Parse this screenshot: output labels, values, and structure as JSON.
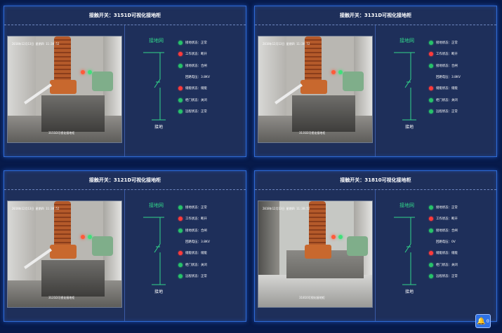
{
  "panels": [
    {
      "title": "接触开关：3151D可视化接地柜",
      "camera": {
        "timestamp": "2018年12月13日 星期四 11:38:52",
        "caption": "3151D可视化接地柜"
      },
      "diagram": {
        "top": "接地网",
        "bottom": "接地"
      },
      "status": [
        {
          "color": "green",
          "text": "接地状态：正常"
        },
        {
          "color": "red",
          "text": "工作状态：断开"
        },
        {
          "color": "green",
          "text": "接地状态：合闸"
        },
        {
          "color": "none",
          "text": "回路电压：3.8KV"
        },
        {
          "color": "red",
          "text": "储能状态：储能"
        },
        {
          "color": "green",
          "text": "柜门状态：关闭"
        },
        {
          "color": "green",
          "text": "远程状态：正常"
        }
      ]
    },
    {
      "title": "接触开关：3131D可视化接地柜",
      "camera": {
        "timestamp": "2018年12月13日 星期四 11:38:52",
        "caption": "3131D可视化接地柜"
      },
      "diagram": {
        "top": "接地网",
        "bottom": "接地"
      },
      "status": [
        {
          "color": "green",
          "text": "接地状态：正常"
        },
        {
          "color": "red",
          "text": "工作状态：断开"
        },
        {
          "color": "green",
          "text": "接地状态：合闸"
        },
        {
          "color": "none",
          "text": "回路电压：3.8KV"
        },
        {
          "color": "red",
          "text": "储能状态：储能"
        },
        {
          "color": "green",
          "text": "柜门状态：关闭"
        },
        {
          "color": "green",
          "text": "远程状态：正常"
        }
      ]
    },
    {
      "title": "接触开关：3121D可视化接地柜",
      "camera": {
        "timestamp": "2018年12月13日 星期四 11:38:52",
        "caption": "3121D可视化接地柜"
      },
      "diagram": {
        "top": "接地网",
        "bottom": "接地"
      },
      "status": [
        {
          "color": "green",
          "text": "接地状态：正常"
        },
        {
          "color": "red",
          "text": "工作状态：断开"
        },
        {
          "color": "green",
          "text": "接地状态：合闸"
        },
        {
          "color": "none",
          "text": "回路电压：3.8KV"
        },
        {
          "color": "red",
          "text": "储能状态：储能"
        },
        {
          "color": "green",
          "text": "柜门状态：关闭"
        },
        {
          "color": "green",
          "text": "远程状态：正常"
        }
      ]
    },
    {
      "title": "接触开关：31810可视化接地柜",
      "camera": {
        "timestamp": "2018年12月13日 星期四 11:38:52",
        "caption": "31810可视化接地柜"
      },
      "diagram": {
        "top": "接地网",
        "bottom": "接地"
      },
      "status": [
        {
          "color": "green",
          "text": "接地状态：正常"
        },
        {
          "color": "red",
          "text": "工作状态：断开"
        },
        {
          "color": "green",
          "text": "接地状态：合闸"
        },
        {
          "color": "none",
          "text": "回路电压：0V"
        },
        {
          "color": "red",
          "text": "储能状态：储能"
        },
        {
          "color": "green",
          "text": "柜门状态：关闭"
        },
        {
          "color": "green",
          "text": "远程状态：正常"
        }
      ]
    }
  ],
  "alarm": {
    "icon": "bell-icon",
    "count": "0"
  },
  "colors": {
    "background": "#071a4a",
    "panel": "#1e2f5a",
    "border": "#2f6bd6",
    "diagram_line": "#31d68a"
  }
}
